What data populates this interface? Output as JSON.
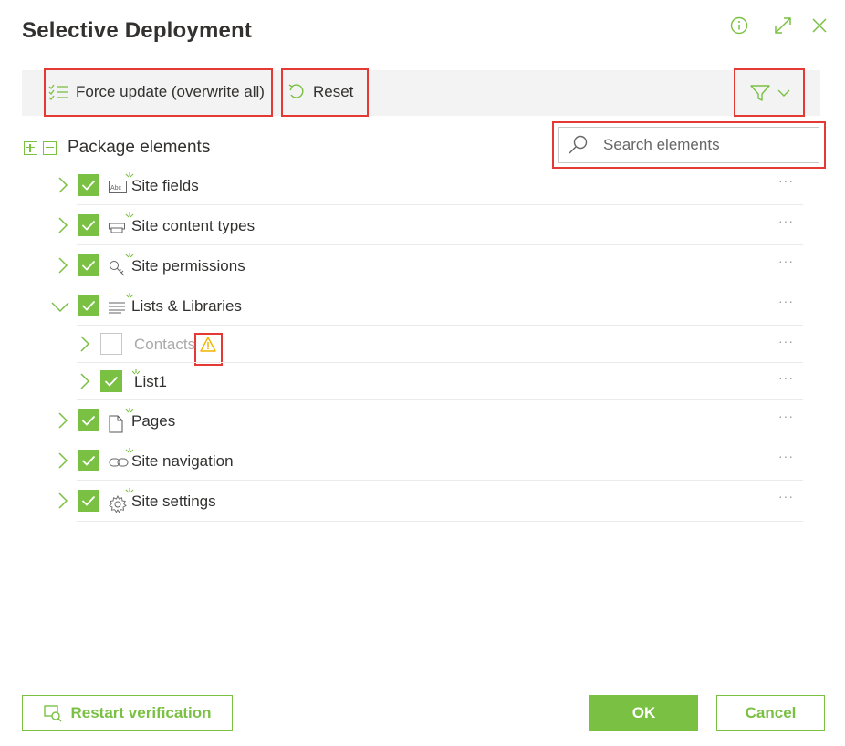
{
  "dialog": {
    "title": "Selective Deployment"
  },
  "header_icons": [
    "info-icon",
    "expand-icon",
    "close-icon"
  ],
  "toolbar": {
    "force_update_label": "Force update (overwrite all)",
    "reset_label": "Reset"
  },
  "tree_header": {
    "label": "Package elements"
  },
  "search": {
    "placeholder": "Search elements"
  },
  "rows": [
    {
      "label": "Site fields",
      "checked": true,
      "icon": "site-fields-icon",
      "expanded": false
    },
    {
      "label": "Site content types",
      "checked": true,
      "icon": "content-types-icon",
      "expanded": false
    },
    {
      "label": "Site permissions",
      "checked": true,
      "icon": "key-icon",
      "expanded": false
    },
    {
      "label": "Lists & Libraries",
      "checked": true,
      "icon": "list-icon",
      "expanded": true
    },
    {
      "label": "Contacts",
      "checked": false,
      "icon": "",
      "level": 2,
      "warning": true
    },
    {
      "label": "List1",
      "checked": true,
      "icon": "",
      "level": 2
    },
    {
      "label": "Pages",
      "checked": true,
      "icon": "page-icon",
      "expanded": false
    },
    {
      "label": "Site navigation",
      "checked": true,
      "icon": "link-icon",
      "expanded": false
    },
    {
      "label": "Site settings",
      "checked": true,
      "icon": "gear-icon",
      "expanded": false
    }
  ],
  "row_menu": "···",
  "footer": {
    "restart_label": "Restart verification",
    "ok_label": "OK",
    "cancel_label": "Cancel"
  },
  "colors": {
    "accent": "#7ac143",
    "highlight": "#e53935",
    "warning": "#f0b400"
  }
}
